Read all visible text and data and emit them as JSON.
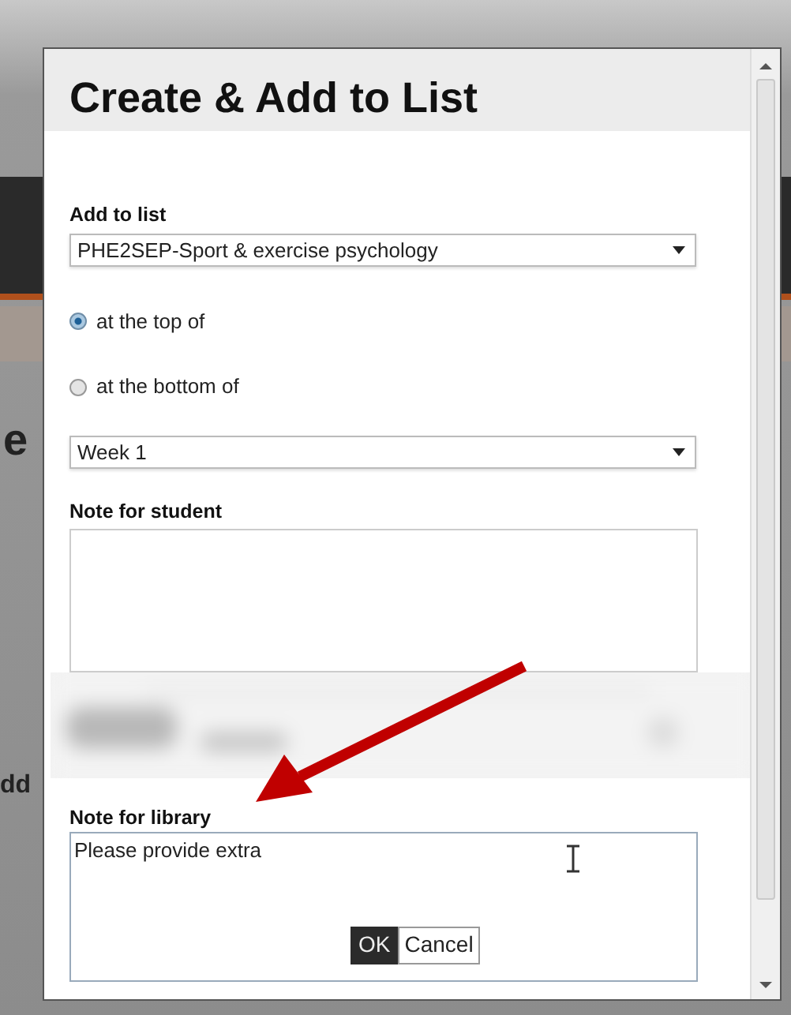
{
  "background": {
    "texts": [
      "e",
      "dd"
    ]
  },
  "dialog": {
    "title": "Create & Add to List",
    "list_field": {
      "label": "Add to list",
      "value": "PHE2SEP-Sport & exercise psychology"
    },
    "position_options": [
      {
        "label": "at the top of",
        "selected": true
      },
      {
        "label": "at the bottom of",
        "selected": false
      }
    ],
    "section_field": {
      "value": "Week 1"
    },
    "student_note": {
      "label": "Note for student"
    },
    "library_note": {
      "label": "Note for library",
      "value": "Please provide extra "
    },
    "buttons": [
      {
        "label": "OK",
        "kind": "primary"
      },
      {
        "label": "Cancel",
        "kind": "secondary"
      }
    ]
  }
}
